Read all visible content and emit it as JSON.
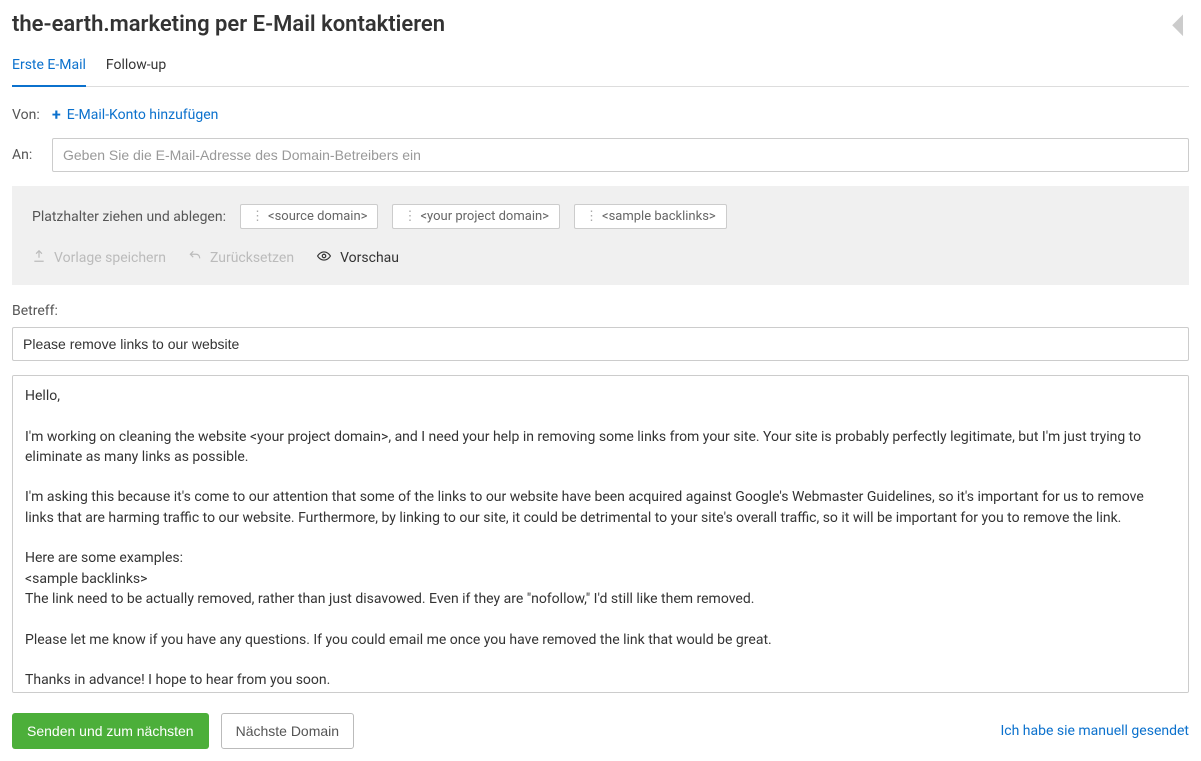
{
  "title": "the-earth.marketing per E-Mail kontaktieren",
  "tabs": {
    "first": "Erste E-Mail",
    "followup": "Follow-up"
  },
  "from": {
    "label": "Von:",
    "add_account": "E-Mail-Konto hinzufügen"
  },
  "to": {
    "label": "An:",
    "placeholder": "Geben Sie die E-Mail-Adresse des Domain-Betreibers ein"
  },
  "placeholders": {
    "label": "Platzhalter ziehen und ablegen:",
    "chips": [
      "<source domain>",
      "<your project domain>",
      "<sample backlinks>"
    ],
    "save_template": "Vorlage speichern",
    "reset": "Zurücksetzen",
    "preview": "Vorschau"
  },
  "subject": {
    "label": "Betreff:",
    "value": "Please remove links to our website"
  },
  "body": "Hello,\n\nI'm working on cleaning the website <your project domain>, and I need your help in removing some links from your site. Your site is probably perfectly legitimate, but I'm just trying to eliminate as many links as possible.\n\nI'm asking this because it's come to our attention that some of the links to our website have been acquired against Google's Webmaster Guidelines, so it's important for us to remove links that are harming traffic to our website. Furthermore, by linking to our site, it could be detrimental to your site's overall traffic, so it will be important for you to remove the link.\n\nHere are some examples:\n<sample backlinks>\nThe link need to be actually removed, rather than just disavowed. Even if they are \"nofollow,\" I'd still like them removed.\n\nPlease let me know if you have any questions. If you could email me once you have removed the link that would be great.\n\nThanks in advance! I hope to hear from you soon.",
  "footer": {
    "send_next": "Senden und zum nächsten",
    "next_domain": "Nächste Domain",
    "manual_sent": "Ich habe sie manuell gesendet"
  }
}
